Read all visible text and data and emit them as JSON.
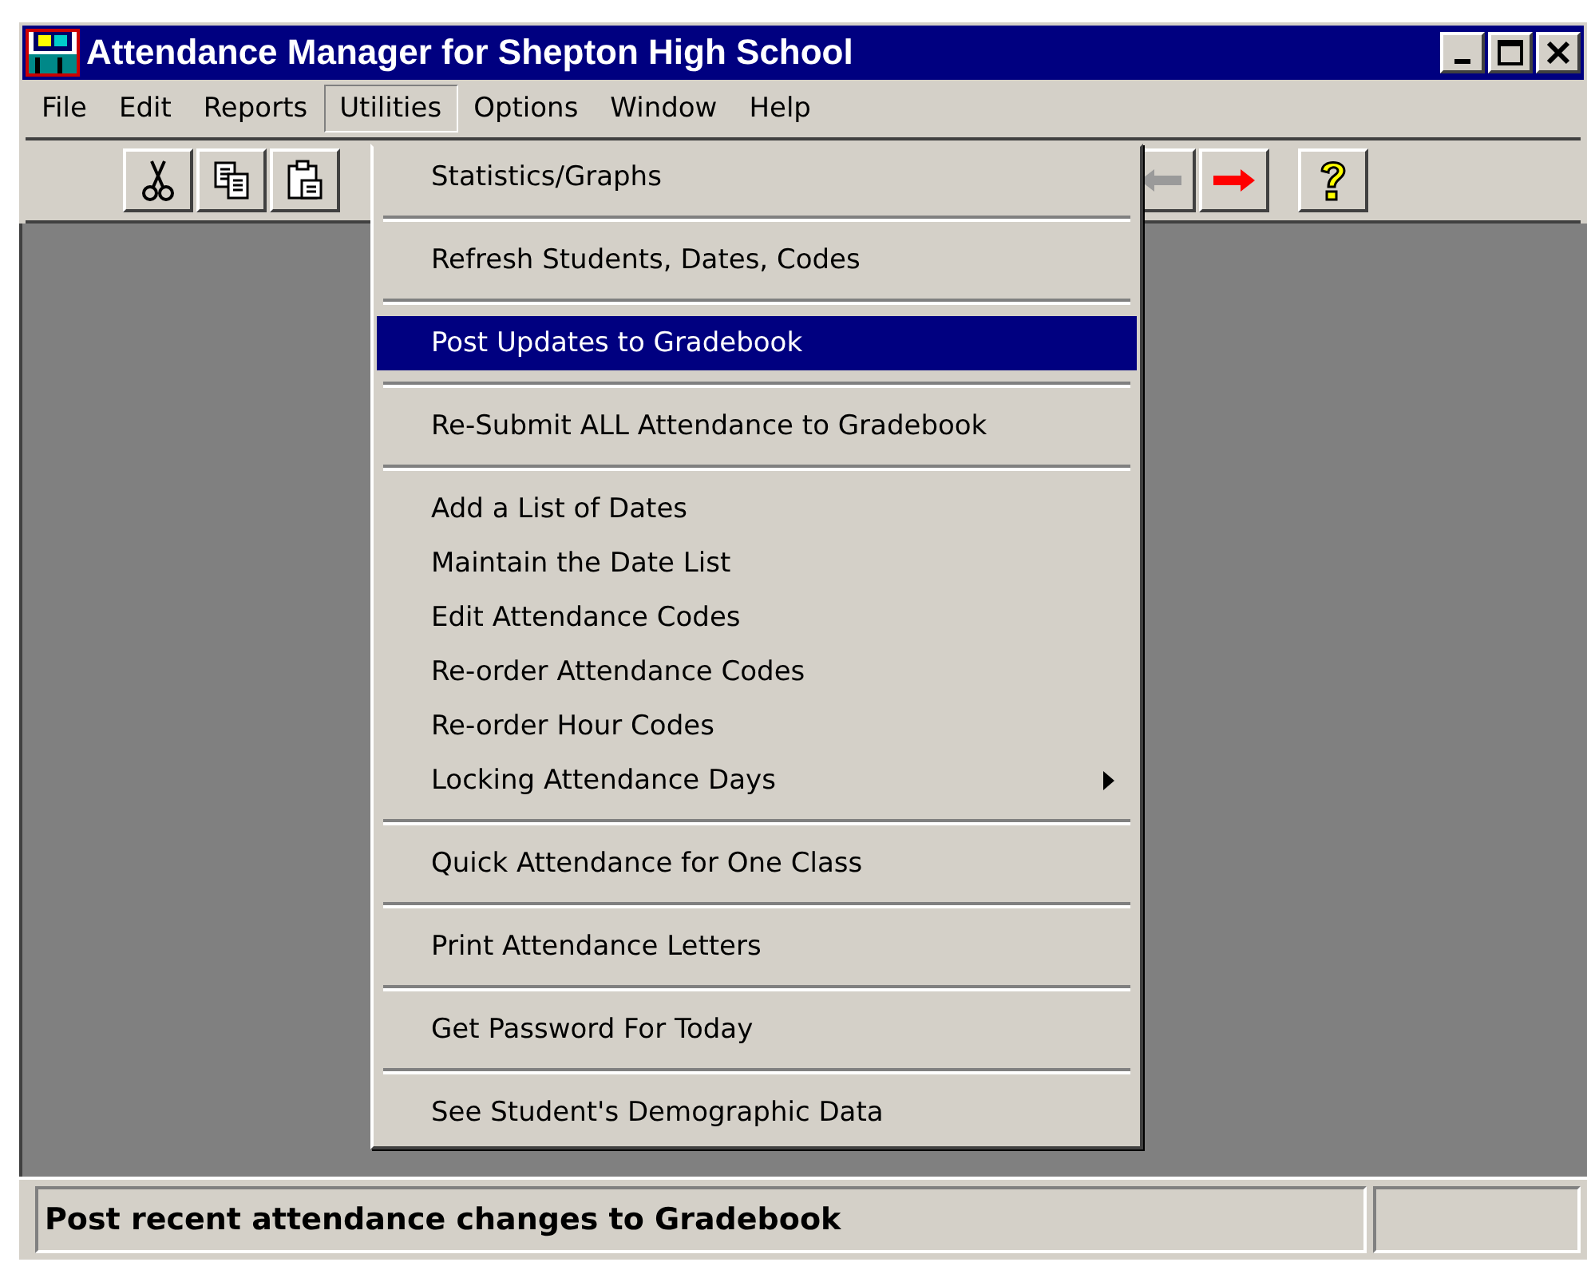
{
  "window": {
    "title": "Attendance Manager for Shepton High School"
  },
  "menu_bar": [
    {
      "label": "File",
      "selected": false
    },
    {
      "label": "Edit",
      "selected": false
    },
    {
      "label": "Reports",
      "selected": false
    },
    {
      "label": "Utilities",
      "selected": true
    },
    {
      "label": "Options",
      "selected": false
    },
    {
      "label": "Window",
      "selected": false
    },
    {
      "label": "Help",
      "selected": false
    }
  ],
  "toolbar": [
    {
      "kind": "cut",
      "disabled": false
    },
    {
      "kind": "copy",
      "disabled": false
    },
    {
      "kind": "paste",
      "disabled": false
    },
    {
      "kind": "back",
      "disabled": true
    },
    {
      "kind": "forward",
      "disabled": false
    },
    {
      "kind": "help",
      "disabled": false
    }
  ],
  "utilities_menu": [
    {
      "kind": "item",
      "label": "Statistics/Graphs",
      "selected": false,
      "submenu": false
    },
    {
      "kind": "separator"
    },
    {
      "kind": "item",
      "label": "Refresh Students, Dates, Codes",
      "selected": false,
      "submenu": false
    },
    {
      "kind": "separator"
    },
    {
      "kind": "item",
      "label": "Post Updates to Gradebook",
      "selected": true,
      "submenu": false
    },
    {
      "kind": "separator"
    },
    {
      "kind": "item",
      "label": "Re-Submit ALL Attendance to Gradebook",
      "selected": false,
      "submenu": false
    },
    {
      "kind": "separator"
    },
    {
      "kind": "item",
      "label": "Add a List of Dates",
      "selected": false,
      "submenu": false
    },
    {
      "kind": "item",
      "label": "Maintain the Date List",
      "selected": false,
      "submenu": false
    },
    {
      "kind": "item",
      "label": "Edit Attendance Codes",
      "selected": false,
      "submenu": false
    },
    {
      "kind": "item",
      "label": "Re-order Attendance Codes",
      "selected": false,
      "submenu": false
    },
    {
      "kind": "item",
      "label": "Re-order Hour Codes",
      "selected": false,
      "submenu": false
    },
    {
      "kind": "item",
      "label": "Locking Attendance Days",
      "selected": false,
      "submenu": true
    },
    {
      "kind": "separator"
    },
    {
      "kind": "item",
      "label": "Quick Attendance for One Class",
      "selected": false,
      "submenu": false
    },
    {
      "kind": "separator"
    },
    {
      "kind": "item",
      "label": "Print Attendance Letters",
      "selected": false,
      "submenu": false
    },
    {
      "kind": "separator"
    },
    {
      "kind": "item",
      "label": "Get Password For Today",
      "selected": false,
      "submenu": false
    },
    {
      "kind": "separator"
    },
    {
      "kind": "item",
      "label": "See Student's Demographic Data",
      "selected": false,
      "submenu": false
    }
  ],
  "status_bar": {
    "message": "Post recent attendance changes to Gradebook"
  }
}
